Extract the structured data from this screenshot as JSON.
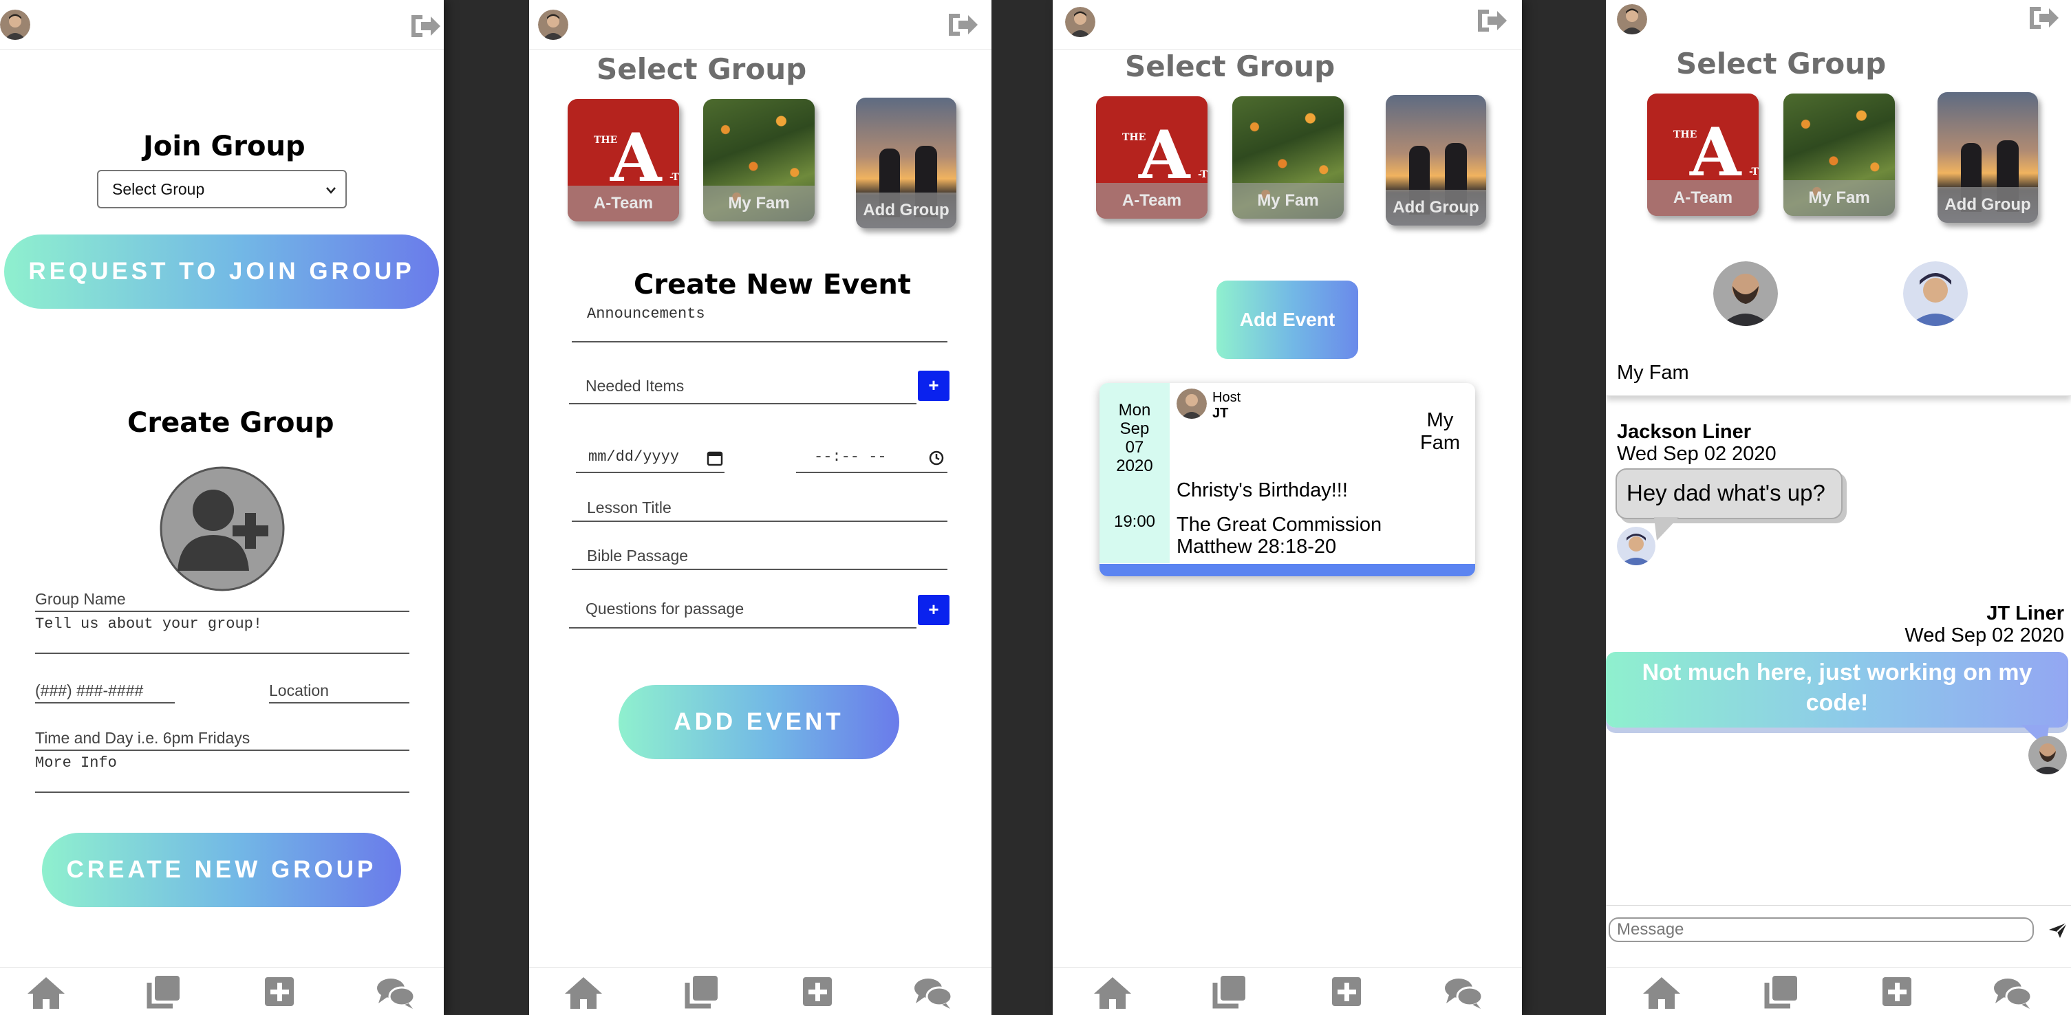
{
  "colors": {
    "accent_blue": "#0a22ee",
    "gradient_start": "#8ff0ce",
    "gradient_end": "#6a7bea",
    "event_bar": "#5b84f1",
    "ateam_red": "#b5231e"
  },
  "icons": {
    "profile": "avatar",
    "logout": "logout-icon",
    "home": "home-icon",
    "groups": "groups-icon",
    "add": "plus-square-icon",
    "chat": "chat-bubbles-icon"
  },
  "panel1": {
    "join_title": "Join Group",
    "select_value": "Select Group",
    "request_button": "REQUEST TO JOIN GROUP",
    "create_title": "Create Group",
    "group_name_placeholder": "Group Name",
    "about_placeholder": "Tell us about your group!",
    "phone_placeholder": "(###) ###-####",
    "location_placeholder": "Location",
    "time_placeholder": "Time and Day i.e. 6pm Fridays",
    "more_info_placeholder": "More Info",
    "create_button": "CREATE NEW GROUP"
  },
  "groups": {
    "title": "Select Group",
    "ateam": "A-Team",
    "myfam": "My Fam",
    "add": "Add Group",
    "logo_the": "THE",
    "logo_a": "A",
    "logo_t": "-T"
  },
  "panel2": {
    "title": "Create New Event",
    "announcements_placeholder": "Announcements",
    "needed_items_placeholder": "Needed Items",
    "date_placeholder": "mm/dd/yyyy",
    "time_placeholder": "--:-- --",
    "lesson_placeholder": "Lesson Title",
    "bible_placeholder": "Bible Passage",
    "questions_placeholder": "Questions for passage",
    "plus": "+",
    "add_button": "ADD EVENT"
  },
  "panel3": {
    "add_event_button": "Add Event",
    "event": {
      "day": "Mon",
      "month": "Sep",
      "date": "07",
      "year": "2020",
      "time": "19:00",
      "host_label": "Host",
      "host_name": "JT",
      "group_line1": "My",
      "group_line2": "Fam",
      "title": "Christy's Birthday!!!",
      "lesson": "The Great Commission",
      "passage": "Matthew 28:18-20"
    }
  },
  "panel4": {
    "group_name": "My Fam",
    "msg1": {
      "sender": "Jackson Liner",
      "date": "Wed Sep 02 2020",
      "text": "Hey dad what's up?"
    },
    "msg2": {
      "sender": "JT Liner",
      "date": "Wed Sep 02 2020",
      "text": "Not much here, just working on my code!"
    },
    "message_placeholder": "Message"
  }
}
